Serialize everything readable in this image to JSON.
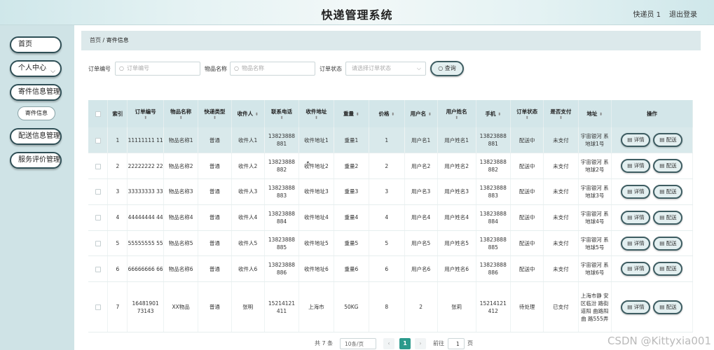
{
  "header": {
    "title": "快递管理系统",
    "user": "快递员 1",
    "logout": "退出登录"
  },
  "sidebar": {
    "home": "首页",
    "personal": "个人中心",
    "mail_mgmt": "寄件信息管理",
    "mail_info": "寄件信息",
    "delivery_mgmt": "配送信息管理",
    "review_mgmt": "服务评价管理"
  },
  "breadcrumb": {
    "home": "首页",
    "sep": "/",
    "current": "寄件信息"
  },
  "filters": {
    "order_no_label": "订单编号",
    "order_no_placeholder": "订单编号",
    "item_name_label": "物品名称",
    "item_name_placeholder": "物品名称",
    "status_label": "订单状态",
    "status_placeholder": "请选择订单状态",
    "query_button": "查询"
  },
  "table": {
    "headers": [
      "索引",
      "订单编号",
      "物品名称",
      "快递类型",
      "收件人",
      "联系电话",
      "收件地址",
      "重量",
      "价格",
      "用户名",
      "用户姓名",
      "手机",
      "订单状态",
      "是否支付",
      "地址",
      "操作"
    ],
    "detail_label": "详情",
    "deliver_label": "配送",
    "rows": [
      {
        "idx": "1",
        "order": "11111111 11",
        "item": "物品名称1",
        "type": "普通",
        "recv": "收件人1",
        "tel": "13823888 881",
        "addr": "收件地址1",
        "weight": "重量1",
        "price": "1",
        "uname": "用户名1",
        "realname": "用户姓名1",
        "phone": "13823888 881",
        "status": "配送中",
        "paid": "未支付",
        "address": "宇宙银河 系地球1号"
      },
      {
        "idx": "2",
        "order": "22222222 22",
        "item": "物品名称2",
        "type": "普通",
        "recv": "收件人2",
        "tel": "13823888 882",
        "addr": "收件地址2",
        "weight": "重量2",
        "price": "2",
        "uname": "用户名2",
        "realname": "用户姓名2",
        "phone": "13823888 882",
        "status": "配送中",
        "paid": "未支付",
        "address": "宇宙银河 系地球2号"
      },
      {
        "idx": "3",
        "order": "33333333 33",
        "item": "物品名称3",
        "type": "普通",
        "recv": "收件人3",
        "tel": "13823888 883",
        "addr": "收件地址3",
        "weight": "重量3",
        "price": "3",
        "uname": "用户名3",
        "realname": "用户姓名3",
        "phone": "13823888 883",
        "status": "配送中",
        "paid": "未支付",
        "address": "宇宙银河 系地球3号"
      },
      {
        "idx": "4",
        "order": "44444444 44",
        "item": "物品名称4",
        "type": "普通",
        "recv": "收件人4",
        "tel": "13823888 884",
        "addr": "收件地址4",
        "weight": "重量4",
        "price": "4",
        "uname": "用户名4",
        "realname": "用户姓名4",
        "phone": "13823888 884",
        "status": "配送中",
        "paid": "未支付",
        "address": "宇宙银河 系地球4号"
      },
      {
        "idx": "5",
        "order": "55555555 55",
        "item": "物品名称5",
        "type": "普通",
        "recv": "收件人5",
        "tel": "13823888 885",
        "addr": "收件地址5",
        "weight": "重量5",
        "price": "5",
        "uname": "用户名5",
        "realname": "用户姓名5",
        "phone": "13823888 885",
        "status": "配送中",
        "paid": "未支付",
        "address": "宇宙银河 系地球5号"
      },
      {
        "idx": "6",
        "order": "66666666 66",
        "item": "物品名称6",
        "type": "普通",
        "recv": "收件人6",
        "tel": "13823888 886",
        "addr": "收件地址6",
        "weight": "重量6",
        "price": "6",
        "uname": "用户名6",
        "realname": "用户姓名6",
        "phone": "13823888 886",
        "status": "配送中",
        "paid": "未支付",
        "address": "宇宙银河 系地球6号"
      },
      {
        "idx": "7",
        "order": "16481901 73143",
        "item": "XX物品",
        "type": "普通",
        "recv": "张明",
        "tel": "15214121 411",
        "addr": "上海市",
        "weight": "50KG",
        "price": "8",
        "uname": "2",
        "realname": "张莉",
        "phone": "15214121 412",
        "status": "待处理",
        "paid": "已支付",
        "address": "上海市静 安区临汾 路街道阳 曲路阳曲 路555弄"
      }
    ]
  },
  "pagination": {
    "total": "共 7 条",
    "page_size": "10条/页",
    "prev": "‹",
    "current": "1",
    "next": "›",
    "goto_label": "前往",
    "goto_value": "1",
    "goto_suffix": "页"
  },
  "watermark": "CSDN @Kittyxia001"
}
